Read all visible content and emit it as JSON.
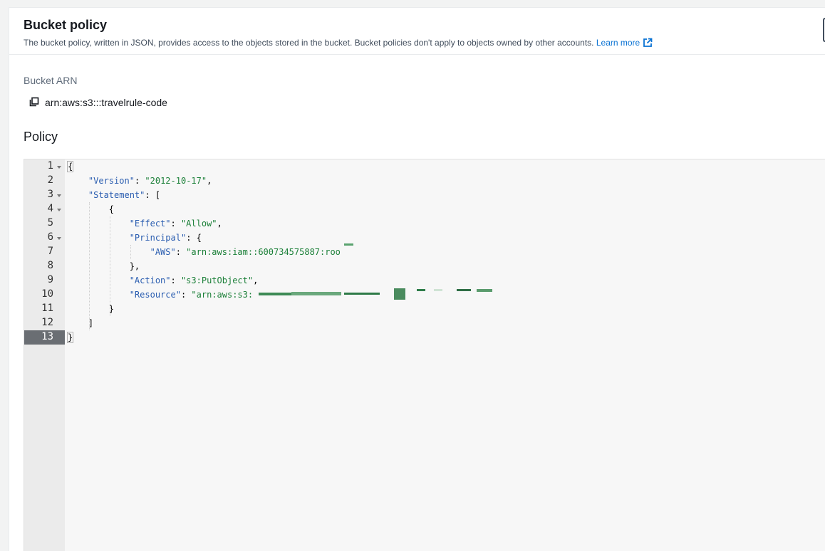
{
  "panel": {
    "title": "Bucket policy",
    "description": "The bucket policy, written in JSON, provides access to the objects stored in the bucket. Bucket policies don't apply to objects owned by other accounts.",
    "learn_more": "Learn more",
    "arn_label": "Bucket ARN",
    "arn_value": "arn:aws:s3:::travelrule-code",
    "policy_heading": "Policy"
  },
  "editor": {
    "line_numbers": [
      "1",
      "2",
      "3",
      "4",
      "5",
      "6",
      "7",
      "8",
      "9",
      "10",
      "11",
      "12",
      "13"
    ],
    "active_line": "13",
    "lines": {
      "l1_open": "{",
      "l2_key": "\"Version\"",
      "l2_val": "\"2012-10-17\"",
      "l3_key": "\"Statement\"",
      "l3_open": "[",
      "l4_open": "{",
      "l5_key": "\"Effect\"",
      "l5_val": "\"Allow\"",
      "l6_key": "\"Principal\"",
      "l6_open": "{",
      "l7_key": "\"AWS\"",
      "l7_val": "\"arn:aws:iam::600734575887:roo",
      "l8_close": "},",
      "l9_key": "\"Action\"",
      "l9_val": "\"s3:PutObject\"",
      "l10_key": "\"Resource\"",
      "l10_val": "\"arn:aws:s3:",
      "l11_close": "}",
      "l12_close": "]",
      "l13_close": "}"
    }
  },
  "colors": {
    "key": "#2a5db0",
    "string": "#1a7f37",
    "link": "#0972d3"
  },
  "icons": [
    "copy-icon",
    "external-link-icon",
    "fold-caret-icon"
  ]
}
